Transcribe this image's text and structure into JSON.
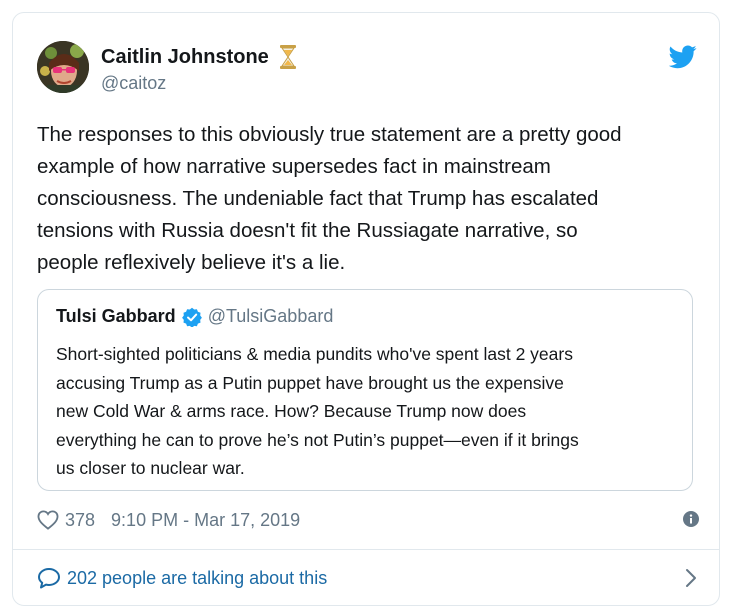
{
  "author": {
    "display_name": "Caitlin Johnstone",
    "handle": "@caitoz",
    "name_emoji_icon": "hourglass-icon"
  },
  "tweet": {
    "text_lines": [
      "The responses to this obviously true statement are a pretty good",
      "example of how narrative supersedes fact in mainstream",
      "consciousness. The undeniable fact that Trump has escalated",
      "tensions with Russia doesn't fit the Russiagate narrative, so",
      "people reflexively believe it's a lie."
    ]
  },
  "quoted": {
    "display_name": "Tulsi Gabbard",
    "handle": "@TulsiGabbard",
    "verified_icon": "verified-badge-icon",
    "text_lines": [
      "Short-sighted politicians & media pundits who've spent last 2 years",
      "accusing Trump as a Putin puppet have brought us the expensive",
      "new Cold War & arms race. How? Because Trump now does",
      "everything he can to prove he’s not Putin’s puppet—even if it brings",
      "us closer to nuclear war."
    ]
  },
  "meta": {
    "like_count": "378",
    "timestamp": "9:10 PM - Mar 17, 2019"
  },
  "footer": {
    "talking_text": "202 people are talking about this"
  },
  "colors": {
    "twitter_blue": "#1da1f2",
    "link_blue": "#1b6aa5",
    "secondary_text": "#657786",
    "border": "#e1e8ed"
  }
}
